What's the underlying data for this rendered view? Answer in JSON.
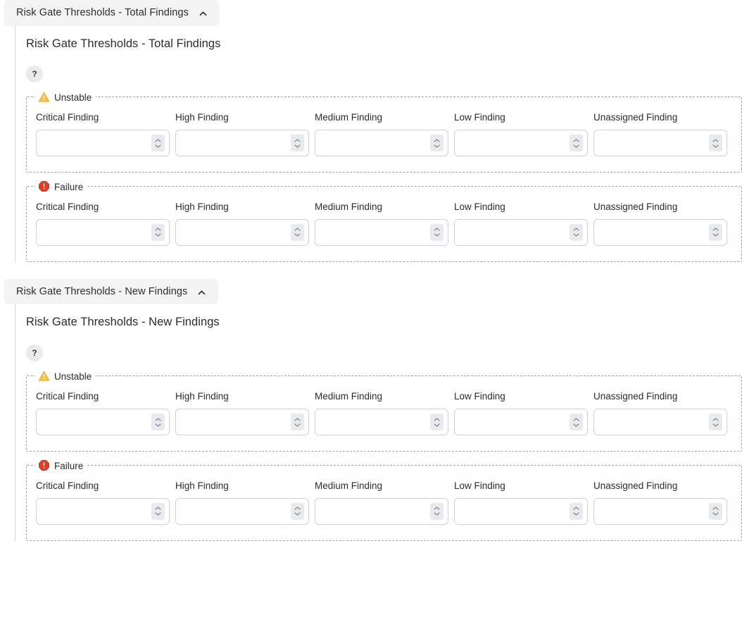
{
  "sections": [
    {
      "accordion_label": "Risk Gate Thresholds - Total Findings",
      "accordion_chevron_icon": "chevron-up-icon",
      "panel_title": "Risk Gate Thresholds - Total Findings",
      "help_label": "?",
      "help_icon": "help-question-icon",
      "groups": [
        {
          "legend": "Unstable",
          "legend_icon": "warning-triangle-icon",
          "legend_icon_color": "#f5c243",
          "fields": [
            {
              "label": "Critical Finding",
              "value": "",
              "placeholder": ""
            },
            {
              "label": "High Finding",
              "value": "",
              "placeholder": ""
            },
            {
              "label": "Medium Finding",
              "value": "",
              "placeholder": ""
            },
            {
              "label": "Low Finding",
              "value": "",
              "placeholder": ""
            },
            {
              "label": "Unassigned Finding",
              "value": "",
              "placeholder": ""
            }
          ]
        },
        {
          "legend": "Failure",
          "legend_icon": "error-octagon-icon",
          "legend_icon_color": "#e23c26",
          "fields": [
            {
              "label": "Critical Finding",
              "value": "",
              "placeholder": ""
            },
            {
              "label": "High Finding",
              "value": "",
              "placeholder": ""
            },
            {
              "label": "Medium Finding",
              "value": "",
              "placeholder": ""
            },
            {
              "label": "Low Finding",
              "value": "",
              "placeholder": ""
            },
            {
              "label": "Unassigned Finding",
              "value": "",
              "placeholder": ""
            }
          ]
        }
      ]
    },
    {
      "accordion_label": "Risk Gate Thresholds - New Findings",
      "accordion_chevron_icon": "chevron-up-icon",
      "panel_title": "Risk Gate Thresholds - New Findings",
      "help_label": "?",
      "help_icon": "help-question-icon",
      "groups": [
        {
          "legend": "Unstable",
          "legend_icon": "warning-triangle-icon",
          "legend_icon_color": "#f5c243",
          "fields": [
            {
              "label": "Critical Finding",
              "value": "",
              "placeholder": ""
            },
            {
              "label": "High Finding",
              "value": "",
              "placeholder": ""
            },
            {
              "label": "Medium Finding",
              "value": "",
              "placeholder": ""
            },
            {
              "label": "Low Finding",
              "value": "",
              "placeholder": ""
            },
            {
              "label": "Unassigned Finding",
              "value": "",
              "placeholder": ""
            }
          ]
        },
        {
          "legend": "Failure",
          "legend_icon": "error-octagon-icon",
          "legend_icon_color": "#e23c26",
          "fields": [
            {
              "label": "Critical Finding",
              "value": "",
              "placeholder": ""
            },
            {
              "label": "High Finding",
              "value": "",
              "placeholder": ""
            },
            {
              "label": "Medium Finding",
              "value": "",
              "placeholder": ""
            },
            {
              "label": "Low Finding",
              "value": "",
              "placeholder": ""
            },
            {
              "label": "Unassigned Finding",
              "value": "",
              "placeholder": ""
            }
          ]
        }
      ]
    }
  ],
  "colors": {
    "accordion_bg": "#f4f4f5",
    "panel_rule": "#d6d9dc",
    "fieldset_dash": "#9aa4ad",
    "input_border": "#ccd2d9",
    "spinner_bg": "#e9eaee",
    "warning": "#f5c243",
    "error": "#e23c26",
    "text": "#2b2b31"
  }
}
